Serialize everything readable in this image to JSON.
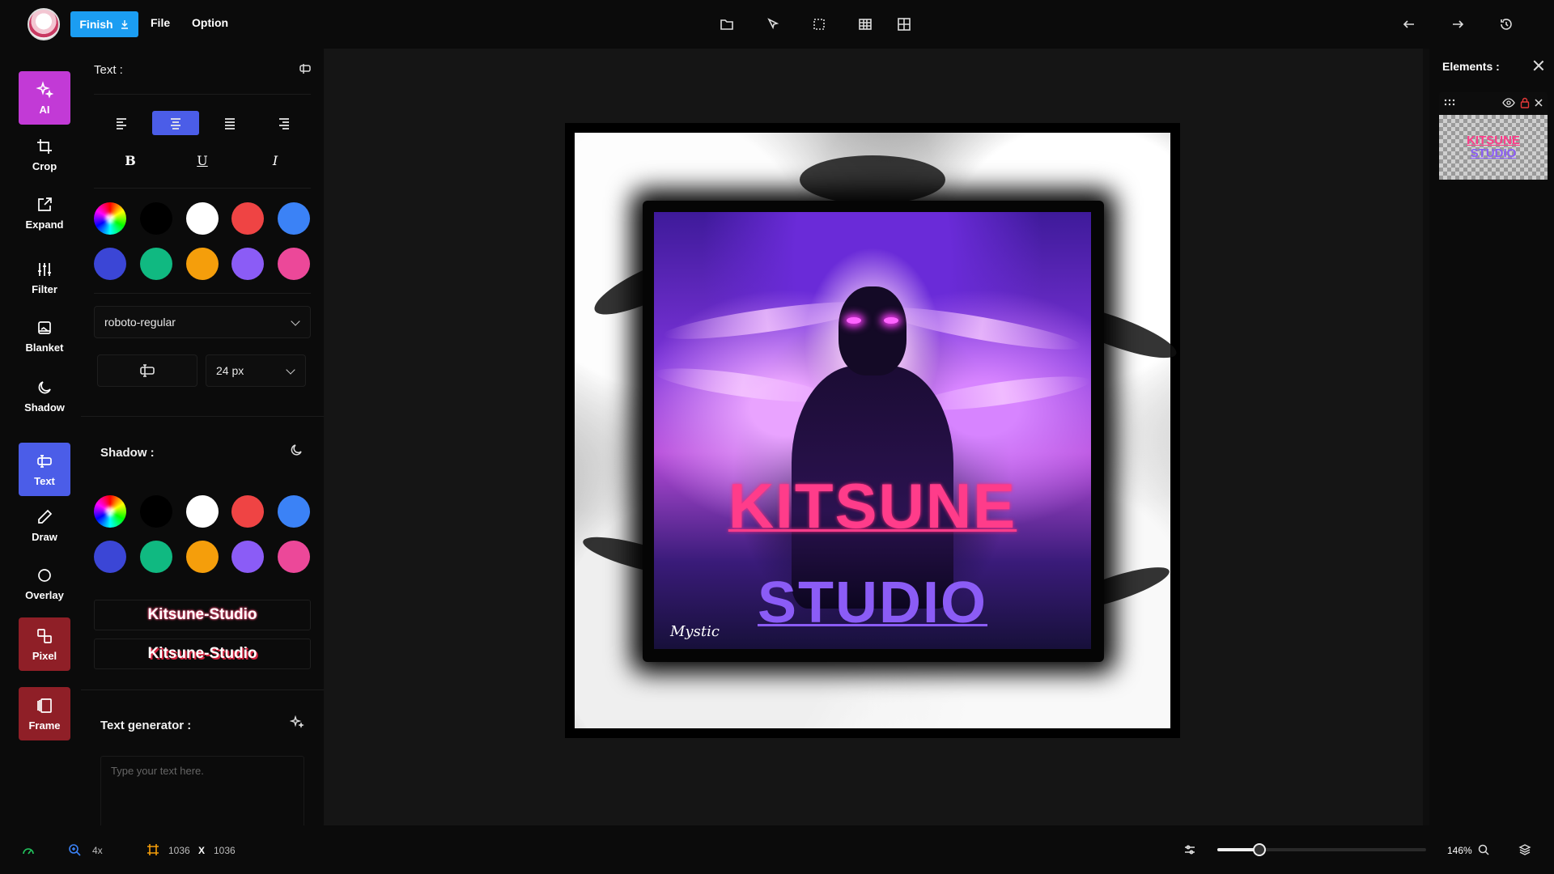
{
  "header": {
    "finish_label": "Finish",
    "menu": {
      "file": "File",
      "option": "Option"
    },
    "tools": [
      "folder-icon",
      "pointer-icon",
      "selection-icon",
      "grid-icon",
      "table-icon"
    ],
    "right_tools": [
      "undo-icon",
      "redo-icon",
      "history-icon"
    ]
  },
  "left_tools": [
    {
      "label": "AI",
      "icon": "sparkles-icon",
      "active": true
    },
    {
      "label": "Crop",
      "icon": "crop-icon"
    },
    {
      "label": "Expand",
      "icon": "expand-icon"
    },
    {
      "label": "Filter",
      "icon": "sliders-icon"
    },
    {
      "label": "Blanket",
      "icon": "blanket-icon"
    },
    {
      "label": "Shadow",
      "icon": "moon-icon"
    },
    {
      "label": "Text",
      "icon": "text-cursor-icon",
      "active": true
    },
    {
      "label": "Draw",
      "icon": "pencil-icon"
    },
    {
      "label": "Overlay",
      "icon": "circle-icon"
    },
    {
      "label": "Pixel",
      "icon": "pixel-icon"
    },
    {
      "label": "Frame",
      "icon": "frame-icon"
    }
  ],
  "text_panel": {
    "title": "Text :",
    "alignment_selected": "center",
    "colors": [
      "#000000",
      "#ffffff",
      "#ef4444",
      "#3b82f6",
      "#3b46d6",
      "#10b981",
      "#f59e0b",
      "#8b5cf6",
      "#ec4899"
    ],
    "font": "roboto-regular",
    "size": "24 px"
  },
  "shadow_panel": {
    "title": "Shadow :",
    "colors": [
      "#000000",
      "#ffffff",
      "#ef4444",
      "#3b82f6",
      "#3b46d6",
      "#10b981",
      "#f59e0b",
      "#8b5cf6",
      "#ec4899"
    ],
    "previews": [
      "Kitsune-Studio",
      "Kitsune-Studio"
    ]
  },
  "generator": {
    "title": "Text generator :",
    "placeholder": "Type your text here."
  },
  "canvas": {
    "line1": "KITSUNE",
    "line2": "STUDIO",
    "signature": "Mystic"
  },
  "elements_panel": {
    "title": "Elements :",
    "thumb_line1": "KITSUNE",
    "thumb_line2": "STUDIO"
  },
  "status": {
    "zoom_factor": "4x",
    "width": "1036",
    "separator": "X",
    "height": "1036",
    "zoom_percent": "146%",
    "zoom_slider_fraction": 0.2
  }
}
